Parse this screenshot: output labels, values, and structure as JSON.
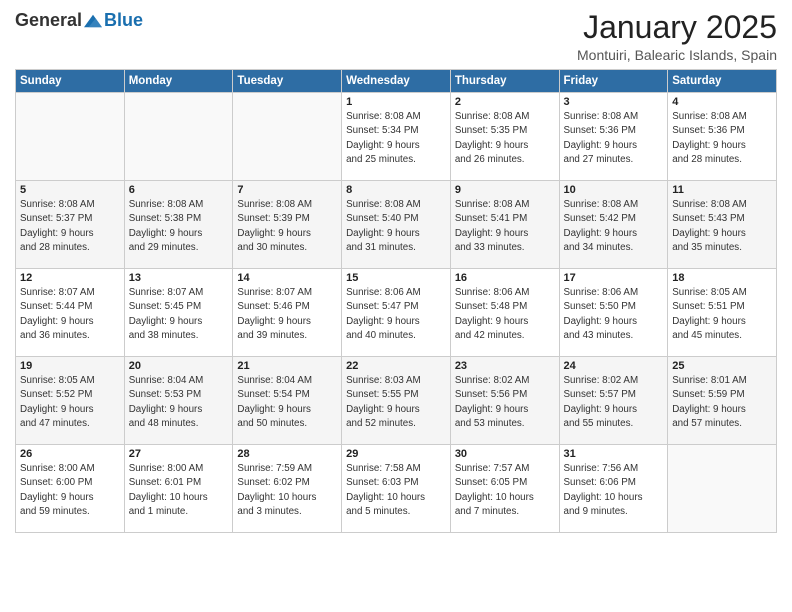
{
  "header": {
    "logo_general": "General",
    "logo_blue": "Blue",
    "title": "January 2025",
    "subtitle": "Montuiri, Balearic Islands, Spain"
  },
  "weekdays": [
    "Sunday",
    "Monday",
    "Tuesday",
    "Wednesday",
    "Thursday",
    "Friday",
    "Saturday"
  ],
  "weeks": [
    [
      {
        "day": "",
        "info": ""
      },
      {
        "day": "",
        "info": ""
      },
      {
        "day": "",
        "info": ""
      },
      {
        "day": "1",
        "info": "Sunrise: 8:08 AM\nSunset: 5:34 PM\nDaylight: 9 hours\nand 25 minutes."
      },
      {
        "day": "2",
        "info": "Sunrise: 8:08 AM\nSunset: 5:35 PM\nDaylight: 9 hours\nand 26 minutes."
      },
      {
        "day": "3",
        "info": "Sunrise: 8:08 AM\nSunset: 5:36 PM\nDaylight: 9 hours\nand 27 minutes."
      },
      {
        "day": "4",
        "info": "Sunrise: 8:08 AM\nSunset: 5:36 PM\nDaylight: 9 hours\nand 28 minutes."
      }
    ],
    [
      {
        "day": "5",
        "info": "Sunrise: 8:08 AM\nSunset: 5:37 PM\nDaylight: 9 hours\nand 28 minutes."
      },
      {
        "day": "6",
        "info": "Sunrise: 8:08 AM\nSunset: 5:38 PM\nDaylight: 9 hours\nand 29 minutes."
      },
      {
        "day": "7",
        "info": "Sunrise: 8:08 AM\nSunset: 5:39 PM\nDaylight: 9 hours\nand 30 minutes."
      },
      {
        "day": "8",
        "info": "Sunrise: 8:08 AM\nSunset: 5:40 PM\nDaylight: 9 hours\nand 31 minutes."
      },
      {
        "day": "9",
        "info": "Sunrise: 8:08 AM\nSunset: 5:41 PM\nDaylight: 9 hours\nand 33 minutes."
      },
      {
        "day": "10",
        "info": "Sunrise: 8:08 AM\nSunset: 5:42 PM\nDaylight: 9 hours\nand 34 minutes."
      },
      {
        "day": "11",
        "info": "Sunrise: 8:08 AM\nSunset: 5:43 PM\nDaylight: 9 hours\nand 35 minutes."
      }
    ],
    [
      {
        "day": "12",
        "info": "Sunrise: 8:07 AM\nSunset: 5:44 PM\nDaylight: 9 hours\nand 36 minutes."
      },
      {
        "day": "13",
        "info": "Sunrise: 8:07 AM\nSunset: 5:45 PM\nDaylight: 9 hours\nand 38 minutes."
      },
      {
        "day": "14",
        "info": "Sunrise: 8:07 AM\nSunset: 5:46 PM\nDaylight: 9 hours\nand 39 minutes."
      },
      {
        "day": "15",
        "info": "Sunrise: 8:06 AM\nSunset: 5:47 PM\nDaylight: 9 hours\nand 40 minutes."
      },
      {
        "day": "16",
        "info": "Sunrise: 8:06 AM\nSunset: 5:48 PM\nDaylight: 9 hours\nand 42 minutes."
      },
      {
        "day": "17",
        "info": "Sunrise: 8:06 AM\nSunset: 5:50 PM\nDaylight: 9 hours\nand 43 minutes."
      },
      {
        "day": "18",
        "info": "Sunrise: 8:05 AM\nSunset: 5:51 PM\nDaylight: 9 hours\nand 45 minutes."
      }
    ],
    [
      {
        "day": "19",
        "info": "Sunrise: 8:05 AM\nSunset: 5:52 PM\nDaylight: 9 hours\nand 47 minutes."
      },
      {
        "day": "20",
        "info": "Sunrise: 8:04 AM\nSunset: 5:53 PM\nDaylight: 9 hours\nand 48 minutes."
      },
      {
        "day": "21",
        "info": "Sunrise: 8:04 AM\nSunset: 5:54 PM\nDaylight: 9 hours\nand 50 minutes."
      },
      {
        "day": "22",
        "info": "Sunrise: 8:03 AM\nSunset: 5:55 PM\nDaylight: 9 hours\nand 52 minutes."
      },
      {
        "day": "23",
        "info": "Sunrise: 8:02 AM\nSunset: 5:56 PM\nDaylight: 9 hours\nand 53 minutes."
      },
      {
        "day": "24",
        "info": "Sunrise: 8:02 AM\nSunset: 5:57 PM\nDaylight: 9 hours\nand 55 minutes."
      },
      {
        "day": "25",
        "info": "Sunrise: 8:01 AM\nSunset: 5:59 PM\nDaylight: 9 hours\nand 57 minutes."
      }
    ],
    [
      {
        "day": "26",
        "info": "Sunrise: 8:00 AM\nSunset: 6:00 PM\nDaylight: 9 hours\nand 59 minutes."
      },
      {
        "day": "27",
        "info": "Sunrise: 8:00 AM\nSunset: 6:01 PM\nDaylight: 10 hours\nand 1 minute."
      },
      {
        "day": "28",
        "info": "Sunrise: 7:59 AM\nSunset: 6:02 PM\nDaylight: 10 hours\nand 3 minutes."
      },
      {
        "day": "29",
        "info": "Sunrise: 7:58 AM\nSunset: 6:03 PM\nDaylight: 10 hours\nand 5 minutes."
      },
      {
        "day": "30",
        "info": "Sunrise: 7:57 AM\nSunset: 6:05 PM\nDaylight: 10 hours\nand 7 minutes."
      },
      {
        "day": "31",
        "info": "Sunrise: 7:56 AM\nSunset: 6:06 PM\nDaylight: 10 hours\nand 9 minutes."
      },
      {
        "day": "",
        "info": ""
      }
    ]
  ]
}
